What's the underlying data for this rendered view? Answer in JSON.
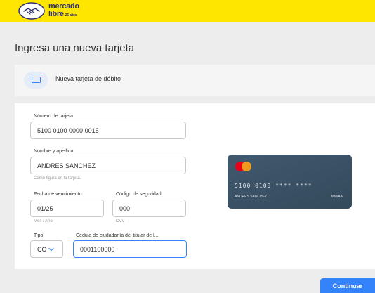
{
  "header": {
    "logo_line1": "mercado",
    "logo_line2": "libre",
    "logo_tagline": "25 años"
  },
  "page_title": "Ingresa una nueva tarjeta",
  "card_option": {
    "icon": "credit-card-icon",
    "label": "Nueva tarjeta de débito"
  },
  "form": {
    "card_number": {
      "label": "Número de tarjeta",
      "value": "5100 0100 0000 0015"
    },
    "full_name": {
      "label": "Nombre y apellido",
      "value": "ANDRES SANCHEZ",
      "helper": "Como figura en la tarjeta."
    },
    "expiry": {
      "label": "Fecha de vencimiento",
      "value": "01/25",
      "helper": "Mes / Año"
    },
    "security_code": {
      "label": "Código de seguridad",
      "value": "000",
      "helper": "CVV"
    },
    "doc_type": {
      "label": "Tipo",
      "value": "CC"
    },
    "doc_number": {
      "label": "Cédula de ciudadanía del titular de l...",
      "value": "0001100000"
    }
  },
  "card_preview": {
    "brand": "mastercard",
    "number": "5100  0100  ****  ****",
    "name": "ANDRES SANCHEZ",
    "expiry": "MM/AA"
  },
  "actions": {
    "continue_label": "Continuar"
  },
  "colors": {
    "header_bg": "#ffe600",
    "accent": "#3483fa",
    "card_bg": "#3e566a"
  }
}
